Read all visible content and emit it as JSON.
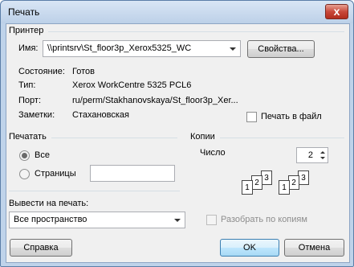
{
  "window": {
    "title": "Печать",
    "close_glyph": "x"
  },
  "printer": {
    "section_label": "Принтер",
    "name_label": "Имя:",
    "name_value": "\\\\printsrv\\St_floor3p_Xerox5325_WC",
    "properties_button": "Свойства...",
    "status_label": "Состояние:",
    "status_value": "Готов",
    "type_label": "Тип:",
    "type_value": "Xerox WorkCentre 5325 PCL6",
    "port_label": "Порт:",
    "port_value": "ru/perm/Stakhanovskaya/St_floor3p_Xer...",
    "notes_label": "Заметки:",
    "notes_value": "Стахановская",
    "print_to_file_label": "Печать в файл"
  },
  "range": {
    "section_label": "Печатать",
    "all_label": "Все",
    "pages_label": "Страницы",
    "pages_value": ""
  },
  "copies": {
    "section_label": "Копии",
    "count_label": "Число",
    "count_value": "2",
    "collate_label": "Разобрать по копиям",
    "collate_stack_1": [
      "1",
      "2",
      "3"
    ],
    "collate_stack_2": [
      "1",
      "2",
      "3"
    ]
  },
  "output": {
    "section_label": "Вывести на печать:",
    "value": "Все пространство"
  },
  "buttons": {
    "help": "Справка",
    "ok": "OK",
    "cancel": "Отмена"
  }
}
